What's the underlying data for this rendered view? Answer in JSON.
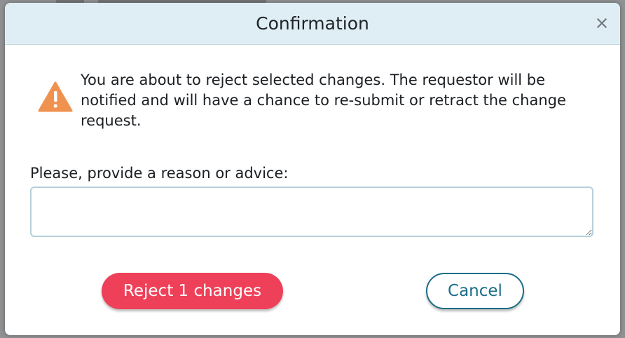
{
  "dialog": {
    "title": "Confirmation",
    "close_icon": "close-icon",
    "warning_icon": "warning-triangle-icon",
    "message": "You are about to reject selected changes. The requestor will be notified and will have a chance to re-submit or retract the change request.",
    "reason_label": "Please, provide a reason or advice:",
    "reason_value": "",
    "reject_label": "Reject 1 changes",
    "cancel_label": "Cancel"
  },
  "colors": {
    "header_bg": "#dfeef5",
    "reject_bg": "#ee4058",
    "cancel_accent": "#1c6d86",
    "warning": "#f0924f"
  }
}
